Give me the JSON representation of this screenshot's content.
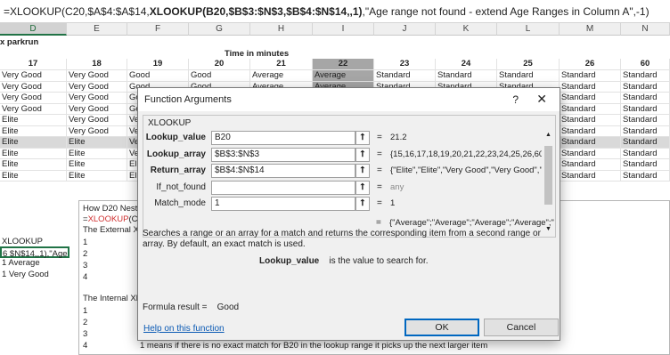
{
  "formula_bar": {
    "part1": "=XLOOKUP(C20,$A$4:$A$14,",
    "part2": "XLOOKUP(",
    "part3": "B20,$B$3:$N$3,$B$4:$N$14,,1)",
    "part4": ",\"Age range not found - extend Age Ranges in Column A\",-1)"
  },
  "sheet": {
    "columns": [
      {
        "name": "D",
        "selected": true
      },
      {
        "name": "E",
        "selected": false
      },
      {
        "name": "F",
        "selected": false
      },
      {
        "name": "G",
        "selected": false
      },
      {
        "name": "H",
        "selected": false
      },
      {
        "name": "I",
        "selected": false
      },
      {
        "name": "J",
        "selected": false
      },
      {
        "name": "K",
        "selected": false
      },
      {
        "name": "L",
        "selected": false
      },
      {
        "name": "M",
        "selected": false
      },
      {
        "name": "N",
        "selected": false
      }
    ],
    "title": "x parkrun",
    "time_header": "Time in minutes",
    "minute_headers": [
      "17",
      "18",
      "19",
      "20",
      "21",
      "22",
      "23",
      "24",
      "25",
      "26",
      "60"
    ],
    "rows": [
      [
        "Very Good",
        "Very Good",
        "Good",
        "Good",
        "Average",
        "Average",
        "Standard",
        "Standard",
        "Standard",
        "Standard",
        "Standard"
      ],
      [
        "Very Good",
        "Very Good",
        "Good",
        "Good",
        "Average",
        "Average",
        "Standard",
        "Standard",
        "Standard",
        "Standard",
        "Standard"
      ],
      [
        "Very Good",
        "Very Good",
        "Go",
        "",
        "",
        "",
        "",
        "",
        "",
        "Standard",
        "Standard"
      ],
      [
        "Very Good",
        "Very Good",
        "Go",
        "",
        "",
        "",
        "",
        "",
        "",
        "Standard",
        "Standard"
      ],
      [
        "Elite",
        "Very Good",
        "Ve",
        "",
        "",
        "",
        "",
        "",
        "",
        "Standard",
        "Standard"
      ],
      [
        "Elite",
        "Very Good",
        "Ve",
        "",
        "",
        "",
        "",
        "",
        "",
        "Standard",
        "Standard"
      ],
      [
        "Elite",
        "Elite",
        "Ve",
        "",
        "",
        "",
        "",
        "",
        "",
        "Standard",
        "Standard"
      ],
      [
        "Elite",
        "Elite",
        "Ve",
        "",
        "",
        "",
        "",
        "",
        "",
        "Standard",
        "Standard"
      ],
      [
        "Elite",
        "Elite",
        "El",
        "",
        "",
        "",
        "",
        "",
        "",
        "Standard",
        "Standard"
      ],
      [
        "Elite",
        "Elite",
        "El",
        "",
        "",
        "",
        "",
        "",
        "",
        "Standard",
        "Standard"
      ]
    ],
    "left_cells": {
      "xlookup": "XLOOKUP",
      "sel_text": "6 $N$14,,1),\"Age",
      "r1": "1 Average",
      "r2": "1 Very Good"
    },
    "textbox": {
      "l1": "How D20 Neste",
      "l2a": "=",
      "l2b": "XLOOKUP",
      "l2c": "(C20,",
      "l3": " The External XL",
      "n1": "1",
      "n2": "2",
      "n3": "3",
      "n4": "4",
      "l4": "The Internal XLO",
      "m1": "1",
      "m2": "2",
      "m3": "3",
      "m4": "4",
      "bottom": "1 means if there is no exact match for B20 in the lookup range it picks up the next larger item"
    }
  },
  "dialog": {
    "title": "Function Arguments",
    "help_q": "?",
    "close": "✕",
    "function_name": "XLOOKUP",
    "args": [
      {
        "label": "Lookup_value",
        "bold": true,
        "value": "B20",
        "result": "21.2",
        "gray": false
      },
      {
        "label": "Lookup_array",
        "bold": true,
        "value": "$B$3:$N$3",
        "result": "{15,16,17,18,19,20,21,22,23,24,25,26,60}",
        "gray": false
      },
      {
        "label": "Return_array",
        "bold": true,
        "value": "$B$4:$N$14",
        "result": "{\"Elite\",\"Elite\",\"Very Good\",\"Very Good\",\"Goo...",
        "gray": false
      },
      {
        "label": "If_not_found",
        "bold": false,
        "value": "",
        "result": "any",
        "gray": true
      },
      {
        "label": "Match_mode",
        "bold": false,
        "value": "1",
        "result": "1",
        "gray": false
      }
    ],
    "eq": "=",
    "result_line": "{\"Average\";\"Average\";\"Average\";\"Average\";\"A...",
    "description": "Searches a range or an array for a match and returns the corresponding item from a second range or array. By default, an exact match is used.",
    "param_name": "Lookup_value",
    "param_desc": "is the value to search for.",
    "formula_result_label": "Formula result =",
    "formula_result_value": "Good",
    "help_link": "Help on this function",
    "ok": "OK",
    "cancel": "Cancel"
  }
}
